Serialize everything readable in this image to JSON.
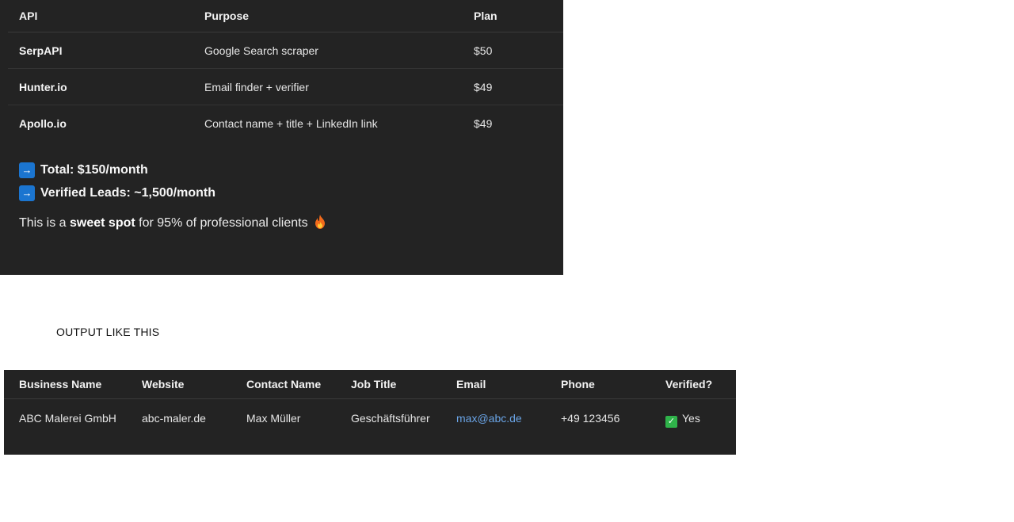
{
  "api_table": {
    "headers": [
      "API",
      "Purpose",
      "Plan"
    ],
    "rows": [
      {
        "api": "SerpAPI",
        "purpose": "Google Search scraper",
        "plan": "$50"
      },
      {
        "api": "Hunter.io",
        "purpose": "Email finder + verifier",
        "plan": "$49"
      },
      {
        "api": "Apollo.io",
        "purpose": "Contact name + title + LinkedIn link",
        "plan": "$49"
      }
    ]
  },
  "summary": {
    "total": "Total: $150/month",
    "verified_leads": "Verified Leads: ~1,500/month",
    "arrow_icon": "right-arrow-icon"
  },
  "sweet_spot": {
    "prefix": "This is a ",
    "bold": "sweet spot",
    "suffix": " for 95% of professional clients",
    "icon": "fire-icon"
  },
  "output_label": "OUTPUT LIKE THIS",
  "lead_table": {
    "headers": [
      "Business Name",
      "Website",
      "Contact Name",
      "Job Title",
      "Email",
      "Phone",
      "Verified?"
    ],
    "rows": [
      {
        "business_name": "ABC Malerei GmbH",
        "website": "abc-maler.de",
        "contact_name": "Max Müller",
        "job_title": "Geschäftsführer",
        "email": "max@abc.de",
        "phone": "+49 123456",
        "verified": "Yes",
        "verified_icon": "check-icon"
      }
    ]
  },
  "colors": {
    "panel_bg": "#232323",
    "link": "#6aa4e6",
    "arrow_badge": "#1b75d0",
    "check_badge": "#2fb34a"
  }
}
